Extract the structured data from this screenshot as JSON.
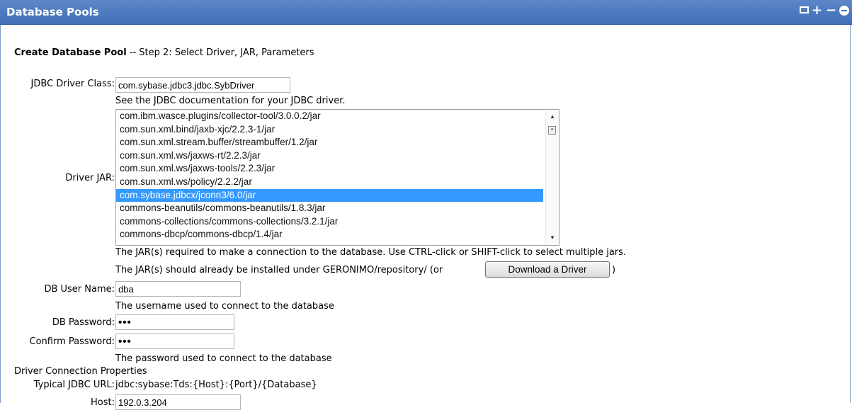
{
  "panel": {
    "title": "Database Pools",
    "window_icons": [
      "maximize-icon",
      "plus-icon",
      "minus-icon",
      "close-circle-icon"
    ]
  },
  "heading": {
    "bold": "Create Database Pool",
    "rest": " -- Step 2: Select Driver, JAR, Parameters"
  },
  "form": {
    "driver_class_label": "JDBC Driver Class:",
    "driver_class_value": "com.sybase.jdbc3.jdbc.SybDriver",
    "driver_class_note": "See the JDBC documentation for your JDBC driver.",
    "driver_jar_label": "Driver JAR:",
    "jars": [
      "com.ibm.wasce.plugins/collector-tool/3.0.0.2/jar",
      "com.sun.xml.bind/jaxb-xjc/2.2.3-1/jar",
      "com.sun.xml.stream.buffer/streambuffer/1.2/jar",
      "com.sun.xml.ws/jaxws-rt/2.2.3/jar",
      "com.sun.xml.ws/jaxws-tools/2.2.3/jar",
      "com.sun.xml.ws/policy/2.2.2/jar",
      "com.sybase.jdbcx/jconn3/6.0/jar",
      "commons-beanutils/commons-beanutils/1.8.3/jar",
      "commons-collections/commons-collections/3.2.1/jar",
      "commons-dbcp/commons-dbcp/1.4/jar"
    ],
    "selected_jar": "com.sybase.jdbcx/jconn3/6.0/jar",
    "jar_note1": "The JAR(s) required to make a connection to the database. Use CTRL-click or SHIFT-click to select multiple jars.",
    "jar_note2_pre": "The JAR(s) should already be installed under GERONIMO/repository/ (or",
    "download_button": "Download a Driver",
    "jar_note2_post": ")",
    "user_label": "DB User Name:",
    "user_value": "dba",
    "user_note": "The username used to connect to the database",
    "password_label": "DB Password:",
    "password_value": "•••",
    "confirm_label": "Confirm Password:",
    "confirm_value": "•••",
    "password_note": "The password used to connect to the database",
    "props_heading": "Driver Connection Properties",
    "url_label": "Typical JDBC URL:",
    "url_value": "jdbc:sybase:Tds:{Host}:{Port}/{Database}",
    "host_label": "Host:",
    "host_value": "192.0.3.204"
  }
}
